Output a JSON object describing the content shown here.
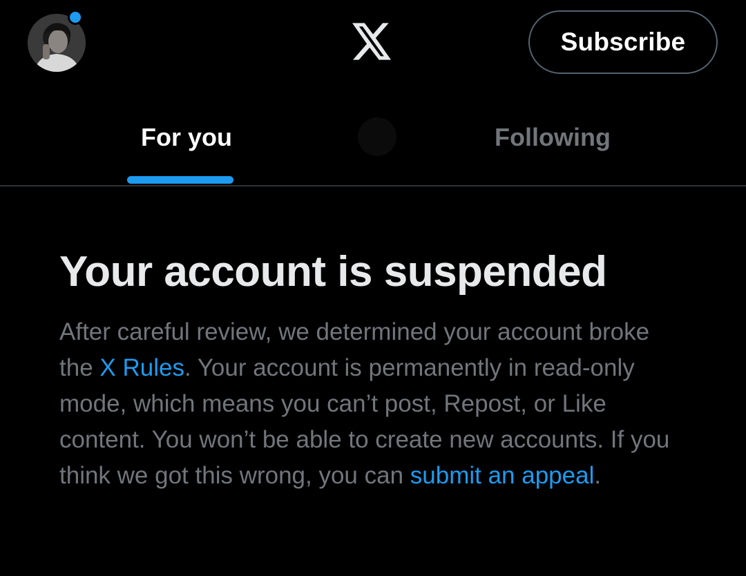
{
  "header": {
    "subscribe_label": "Subscribe",
    "logo_icon": "x-logo-icon"
  },
  "tabs": [
    {
      "label": "For you",
      "active": true
    },
    {
      "label": "Following",
      "active": false
    }
  ],
  "notice": {
    "title": "Your account is suspended",
    "body_part1": "After careful review, we determined your account broke the ",
    "link_rules": "X Rules",
    "body_part2": ". Your account is permanently in read-only mode, which means you can’t post, Repost, or Like content. You won’t be able to create new accounts. If you think we got this wrong, you can ",
    "link_appeal": "submit an appeal",
    "body_part3": "."
  },
  "colors": {
    "background": "#000000",
    "accent": "#1d9bf0",
    "text_primary": "#e7e9ea",
    "text_secondary": "#71767b",
    "border": "#2f3336"
  }
}
